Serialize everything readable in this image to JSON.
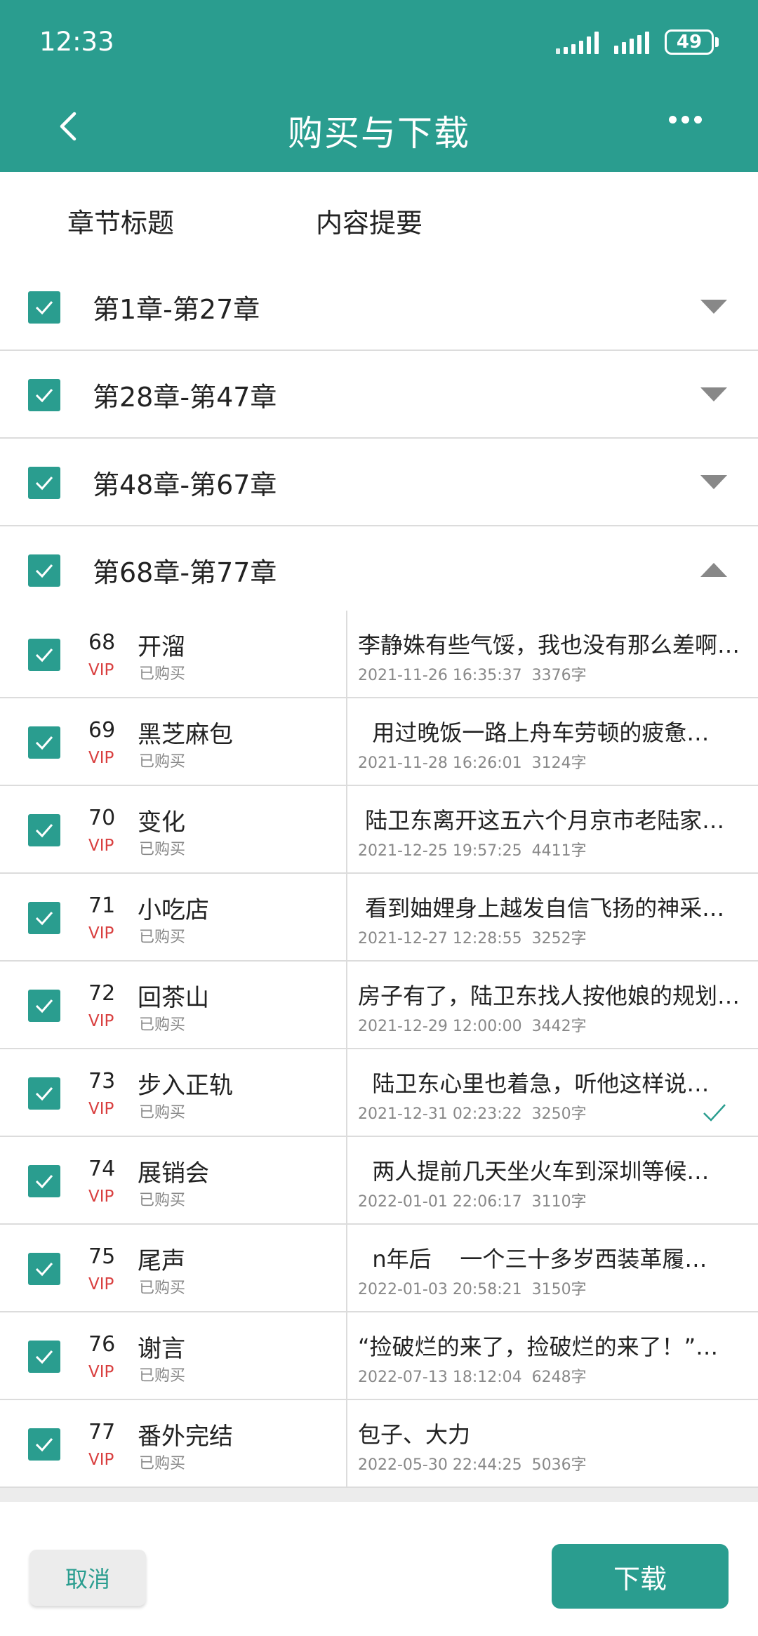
{
  "status_bar": {
    "time": "12:33",
    "battery": "49"
  },
  "header": {
    "title": "购买与下载"
  },
  "tabs": [
    {
      "label": "章节标题"
    },
    {
      "label": "内容提要"
    }
  ],
  "groups": [
    {
      "label": "第1章-第27章",
      "checked": true,
      "expanded": false
    },
    {
      "label": "第28章-第47章",
      "checked": true,
      "expanded": false
    },
    {
      "label": "第48章-第67章",
      "checked": true,
      "expanded": false
    },
    {
      "label": "第68章-第77章",
      "checked": true,
      "expanded": true
    }
  ],
  "chapters": [
    {
      "num": "68",
      "title": "开溜",
      "vip": "VIP",
      "status": "已购买",
      "summary": "李静姝有些气馁，我也没有那么差啊…",
      "meta": "2021-11-26 16:35:37  3376字",
      "downloaded": false
    },
    {
      "num": "69",
      "title": "黑芝麻包",
      "vip": "VIP",
      "status": "已购买",
      "summary": "  用过晚饭一路上舟车劳顿的疲惫…",
      "meta": "2021-11-28 16:26:01  3124字",
      "downloaded": false
    },
    {
      "num": "70",
      "title": "变化",
      "vip": "VIP",
      "status": "已购买",
      "summary": " 陆卫东离开这五六个月京市老陆家…",
      "meta": "2021-12-25 19:57:25  4411字",
      "downloaded": false
    },
    {
      "num": "71",
      "title": "小吃店",
      "vip": "VIP",
      "status": "已购买",
      "summary": " 看到妯娌身上越发自信飞扬的神采…",
      "meta": "2021-12-27 12:28:55  3252字",
      "downloaded": false
    },
    {
      "num": "72",
      "title": "回茶山",
      "vip": "VIP",
      "status": "已购买",
      "summary": "房子有了，陆卫东找人按他娘的规划…",
      "meta": "2021-12-29 12:00:00  3442字",
      "downloaded": false
    },
    {
      "num": "73",
      "title": "步入正轨",
      "vip": "VIP",
      "status": "已购买",
      "summary": "  陆卫东心里也着急，听他这样说…",
      "meta": "2021-12-31 02:23:22  3250字",
      "downloaded": true
    },
    {
      "num": "74",
      "title": "展销会",
      "vip": "VIP",
      "status": "已购买",
      "summary": "  两人提前几天坐火车到深圳等候…",
      "meta": "2022-01-01 22:06:17  3110字",
      "downloaded": false
    },
    {
      "num": "75",
      "title": "尾声",
      "vip": "VIP",
      "status": "已购买",
      "summary": "  n年后    一个三十多岁西装革履…",
      "meta": "2022-01-03 20:58:21  3150字",
      "downloaded": false
    },
    {
      "num": "76",
      "title": "谢言",
      "vip": "VIP",
      "status": "已购买",
      "summary": "“捡破烂的来了，捡破烂的来了！”…",
      "meta": "2022-07-13 18:12:04  6248字",
      "downloaded": false
    },
    {
      "num": "77",
      "title": "番外完结",
      "vip": "VIP",
      "status": "已购买",
      "summary": "包子、大力",
      "meta": "2022-05-30 22:44:25  5036字",
      "downloaded": false
    }
  ],
  "footer": {
    "cancel_label": "取消",
    "download_label": "下载"
  },
  "colors": {
    "accent": "#2a9d8f",
    "vip": "#d94040"
  }
}
